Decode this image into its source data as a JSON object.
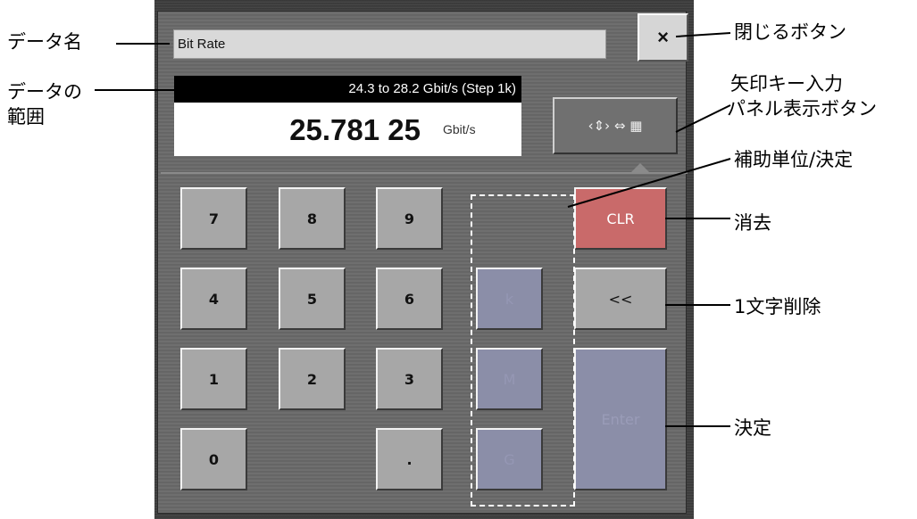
{
  "annotations": {
    "data_name": "データ名",
    "data_range_line1": "データの",
    "data_range_line2": "範囲",
    "close_button": "閉じるボタン",
    "arrow_panel_line1": "矢印キー入力",
    "arrow_panel_line2": "パネル表示ボタン",
    "sub_unit": "補助単位/決定",
    "clear": "消去",
    "backspace": "1文字削除",
    "enter": "決定"
  },
  "dialog": {
    "name": "Bit Rate",
    "close_label": "×",
    "range": "24.3 to 28.2 Gbit/s (Step 1k)",
    "value": "25.781 25",
    "unit": "Gbit/s",
    "arrow_button_label": "‹⇕› ⇔ ▦"
  },
  "keypad": {
    "k7": "7",
    "k8": "8",
    "k9": "9",
    "k4": "4",
    "k5": "5",
    "k6": "6",
    "k1": "1",
    "k2": "2",
    "k3": "3",
    "k0": "0",
    "kdot": ".",
    "kk": "k",
    "km": "M",
    "kg": "G",
    "clr": "CLR",
    "back": "<<",
    "enter": "Enter"
  }
}
